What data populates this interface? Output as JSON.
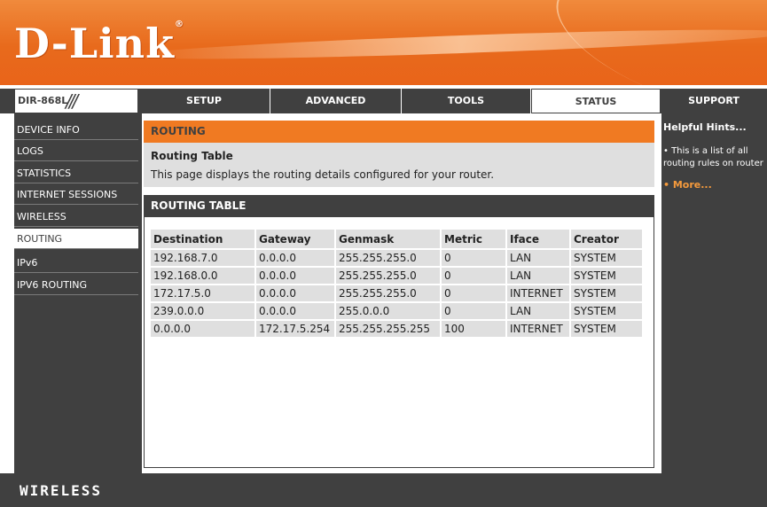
{
  "brand": {
    "logo_text": "D-Link",
    "logo_mark": "®"
  },
  "model": {
    "name": "DIR-868L",
    "slashes": "///"
  },
  "nav": {
    "tabs": [
      {
        "label": "SETUP"
      },
      {
        "label": "ADVANCED"
      },
      {
        "label": "TOOLS"
      },
      {
        "label": "STATUS",
        "active": true
      },
      {
        "label": "SUPPORT"
      }
    ]
  },
  "sidebar": {
    "items": [
      {
        "label": "DEVICE INFO"
      },
      {
        "label": "LOGS"
      },
      {
        "label": "STATISTICS"
      },
      {
        "label": "INTERNET SESSIONS"
      },
      {
        "label": "WIRELESS"
      },
      {
        "label": "ROUTING",
        "active": true
      },
      {
        "label": "IPv6"
      },
      {
        "label": "IPV6 ROUTING"
      }
    ]
  },
  "main": {
    "section_title": "ROUTING",
    "subtitle": "Routing Table",
    "description": "This page displays the routing details configured for your router.",
    "table_title": "ROUTING TABLE",
    "columns": [
      "Destination",
      "Gateway",
      "Genmask",
      "Metric",
      "Iface",
      "Creator"
    ],
    "rows": [
      [
        "192.168.7.0",
        "0.0.0.0",
        "255.255.255.0",
        "0",
        "LAN",
        "SYSTEM"
      ],
      [
        "192.168.0.0",
        "0.0.0.0",
        "255.255.255.0",
        "0",
        "LAN",
        "SYSTEM"
      ],
      [
        "172.17.5.0",
        "0.0.0.0",
        "255.255.255.0",
        "0",
        "INTERNET",
        "SYSTEM"
      ],
      [
        "239.0.0.0",
        "0.0.0.0",
        "255.0.0.0",
        "0",
        "LAN",
        "SYSTEM"
      ],
      [
        "0.0.0.0",
        "172.17.5.254",
        "255.255.255.255",
        "100",
        "INTERNET",
        "SYSTEM"
      ]
    ]
  },
  "hints": {
    "title": "Helpful Hints...",
    "text": "• This is a list of all routing rules on router",
    "more": "• More..."
  },
  "footer": {
    "label": "WIRELESS"
  },
  "colors": {
    "accent": "#f07a22",
    "dark": "#404040",
    "panel": "#dfdfdf"
  }
}
